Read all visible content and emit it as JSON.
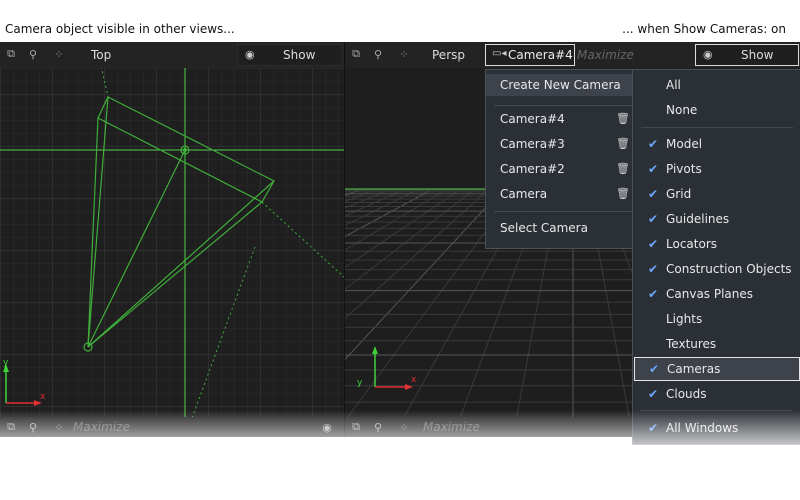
{
  "captions": {
    "left": "Camera object visible in other views...",
    "right": "... when Show Cameras: on"
  },
  "left_viewport": {
    "view_label": "Top",
    "show_label": "Show",
    "maximize_label": "Maximize",
    "axis_y": "y",
    "axis_x": "x"
  },
  "right_viewport": {
    "view_label": "Persp",
    "camera_label": "Camera#4",
    "maximize_label": "Maximize",
    "show_label": "Show",
    "axis_y": "y",
    "axis_x": "x"
  },
  "camera_menu": {
    "create": "Create New Camera",
    "cameras": [
      "Camera#4",
      "Camera#3",
      "Camera#2",
      "Camera"
    ],
    "select": "Select Camera"
  },
  "show_menu": {
    "all": "All",
    "none": "None",
    "items": [
      {
        "label": "Model",
        "checked": true
      },
      {
        "label": "Pivots",
        "checked": true
      },
      {
        "label": "Grid",
        "checked": true
      },
      {
        "label": "Guidelines",
        "checked": true
      },
      {
        "label": "Locators",
        "checked": true
      },
      {
        "label": "Construction Objects",
        "checked": true
      },
      {
        "label": "Canvas Planes",
        "checked": true
      },
      {
        "label": "Lights",
        "checked": false
      },
      {
        "label": "Textures",
        "checked": false
      },
      {
        "label": "Cameras",
        "checked": true
      },
      {
        "label": "Clouds",
        "checked": true
      }
    ],
    "all_windows": "All Windows"
  },
  "colors": {
    "camera_wire": "#3fae3a",
    "guide_green": "#4fd34a",
    "check": "#6fa8ff"
  }
}
